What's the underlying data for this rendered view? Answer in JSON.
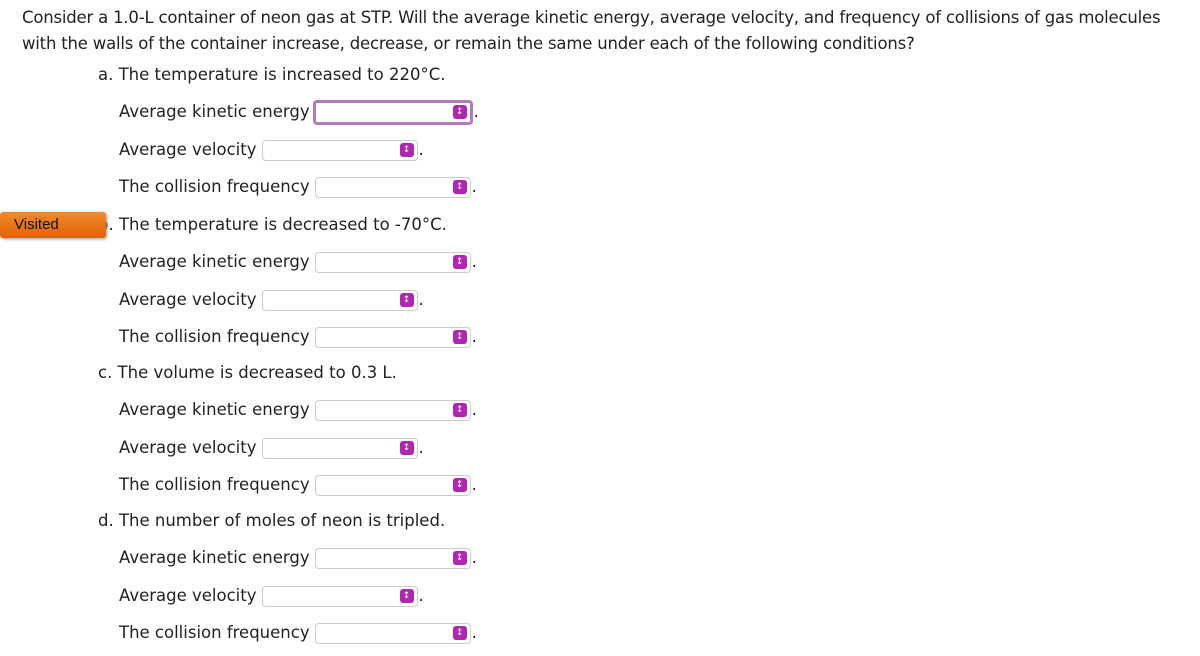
{
  "question": "Consider a 1.0-L container of neon gas at STP. Will the average kinetic energy, average velocity, and frequency of collisions of gas molecules with the walls of the container increase, decrease, or remain the same under each of the following conditions?",
  "badge": "Visited",
  "parts": [
    {
      "label": "a. The temperature is increased to 220°C.",
      "fields": [
        "Average kinetic energy",
        "Average velocity",
        "The collision frequency"
      ]
    },
    {
      "label": "b. The temperature is decreased to -70°C.",
      "fields": [
        "Average kinetic energy",
        "Average velocity",
        "The collision frequency"
      ]
    },
    {
      "label": "c. The volume is decreased to 0.3 L.",
      "fields": [
        "Average kinetic energy",
        "Average velocity",
        "The collision frequency"
      ]
    },
    {
      "label": "d. The number of moles of neon is tripled.",
      "fields": [
        "Average kinetic energy",
        "Average velocity",
        "The collision frequency"
      ]
    }
  ],
  "select_value": "",
  "period": ".",
  "accent": "#b026b0"
}
